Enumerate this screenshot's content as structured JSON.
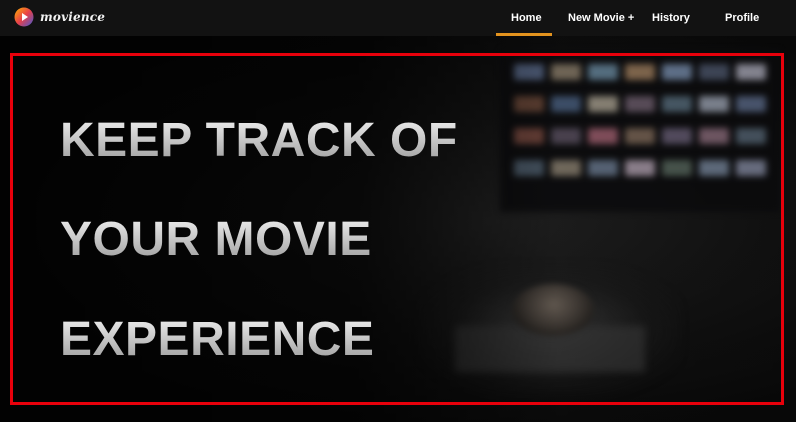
{
  "app": {
    "logo_text": "movience"
  },
  "nav": {
    "items": [
      {
        "label": "Home",
        "active": true
      },
      {
        "label": "New Movie +",
        "active": false
      },
      {
        "label": "History",
        "active": false
      },
      {
        "label": "Profile",
        "active": false
      }
    ],
    "active_color": "#e3931e"
  },
  "hero": {
    "headline_lines": [
      "KEEP TRACK OF",
      "YOUR MOVIE",
      "EXPERIENCE"
    ],
    "highlight_border_color": "#e8000b"
  }
}
